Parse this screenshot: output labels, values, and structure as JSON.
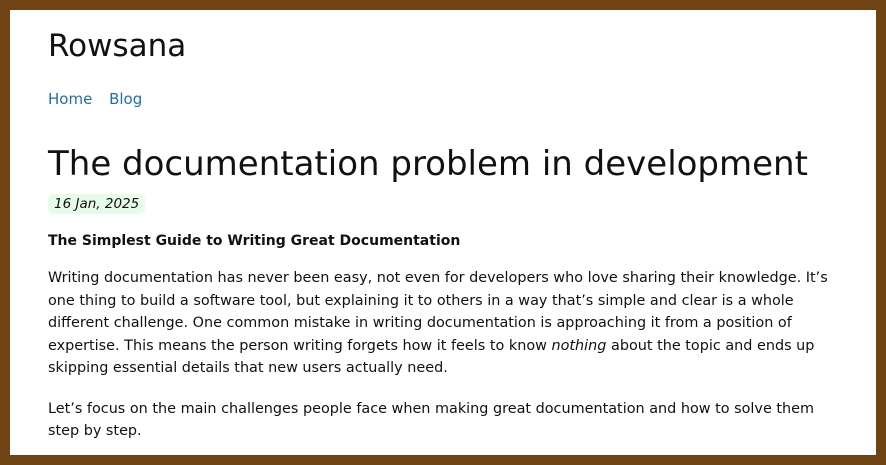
{
  "site": {
    "title": "Rowsana"
  },
  "nav": [
    {
      "label": "Home"
    },
    {
      "label": "Blog"
    }
  ],
  "post": {
    "title": "The documentation problem in development",
    "date": "16 Jan, 2025",
    "subtitle": "The Simplest Guide to Writing Great Documentation",
    "p1_before": "Writing documentation has never been easy, not even for developers who love sharing their knowledge. It’s one thing to build a software tool, but explaining it to others in a way that’s simple and clear is a whole different challenge. One common mistake in writing documentation is approaching it from a position of expertise. This means the person writing forgets how it feels to know ",
    "p1_em": "nothing",
    "p1_after": " about the topic and ends up skipping essential details that new users actually need.",
    "p2": "Let’s focus on the main challenges people face when making great documentation and how to solve them step by step."
  },
  "colors": {
    "border": "#6f4314",
    "link": "#1f6fb0",
    "date_bg": "#e6fbe9"
  }
}
